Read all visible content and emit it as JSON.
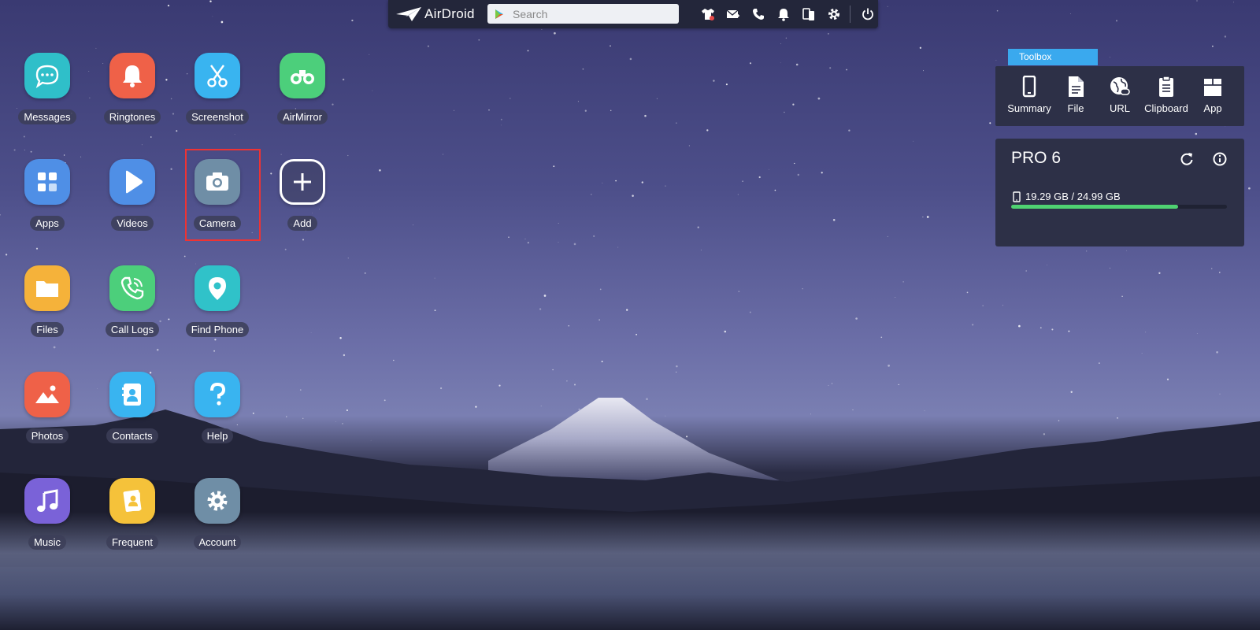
{
  "topbar": {
    "logo_text": "AirDroid",
    "search_placeholder": "Search",
    "icons": [
      "tshirt-icon",
      "mail-icon",
      "phone-icon",
      "bell-icon",
      "mirror-devices-icon",
      "gear-icon",
      "power-icon"
    ]
  },
  "apps": [
    {
      "label": "Messages",
      "color": "#2fbfc9",
      "icon": "message-bubble-icon"
    },
    {
      "label": "Ringtones",
      "color": "#ef6148",
      "icon": "bell-icon"
    },
    {
      "label": "Screenshot",
      "color": "#39b4f0",
      "icon": "scissors-icon"
    },
    {
      "label": "AirMirror",
      "color": "#4ccf7b",
      "icon": "binoculars-icon"
    },
    {
      "label": "Apps",
      "color": "#4f8fe6",
      "icon": "apps-grid-icon"
    },
    {
      "label": "Videos",
      "color": "#4f8fe6",
      "icon": "play-icon"
    },
    {
      "label": "Camera",
      "color": "#6f8ea6",
      "icon": "camera-icon"
    },
    {
      "label": "Add",
      "color": "transparent",
      "icon": "plus-icon"
    },
    {
      "label": "Files",
      "color": "#f5b23a",
      "icon": "folder-icon"
    },
    {
      "label": "Call Logs",
      "color": "#4ccf7b",
      "icon": "phone-call-icon"
    },
    {
      "label": "Find Phone",
      "color": "#30c2c9",
      "icon": "location-pin-icon"
    },
    {
      "label": "Photos",
      "color": "#ef6148",
      "icon": "mountain-photo-icon"
    },
    {
      "label": "Contacts",
      "color": "#39b4f0",
      "icon": "contact-book-icon"
    },
    {
      "label": "Help",
      "color": "#39b4f0",
      "icon": "question-icon"
    },
    {
      "label": "Music",
      "color": "#7a62d8",
      "icon": "music-note-icon"
    },
    {
      "label": "Frequent",
      "color": "#f5c23a",
      "icon": "frequent-contact-icon"
    },
    {
      "label": "Account",
      "color": "#6f8ea6",
      "icon": "gear-icon"
    }
  ],
  "selected_app": "Camera",
  "toolbox": {
    "tab_label": "Toolbox",
    "tools": [
      {
        "label": "Summary",
        "icon": "phone-summary-icon"
      },
      {
        "label": "File",
        "icon": "file-icon"
      },
      {
        "label": "URL",
        "icon": "globe-link-icon"
      },
      {
        "label": "Clipboard",
        "icon": "clipboard-icon"
      },
      {
        "label": "App",
        "icon": "app-box-icon"
      }
    ]
  },
  "device": {
    "name": "PRO 6",
    "storage_text": "19.29 GB / 24.99 GB",
    "storage_used_fraction": 0.772,
    "storage_bar_color": "#4fd272"
  }
}
